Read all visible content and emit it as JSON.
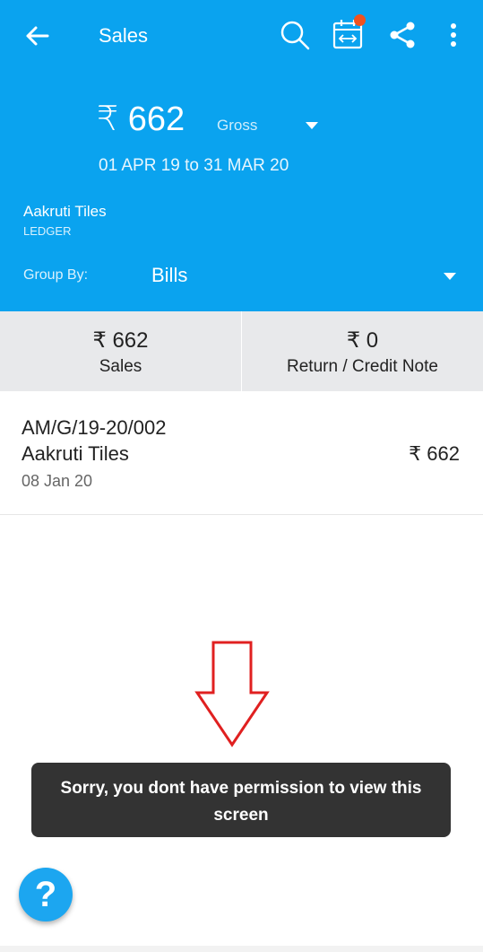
{
  "header": {
    "title": "Sales",
    "amount": "₹ 662",
    "type_select": "Gross",
    "period": "01 APR 19 to 31 MAR 20",
    "ledger_name": "Aakruti Tiles",
    "ledger_type": "LEDGER",
    "group_by_label": "Group By:",
    "group_by_value": "Bills",
    "icons": [
      "back-arrow-icon",
      "search-icon",
      "calendar-range-icon",
      "share-icon",
      "more-vert-icon"
    ],
    "colors": {
      "background": "#0aa3ef",
      "badge": "#f0521e"
    }
  },
  "summary": [
    {
      "value": "₹ 662",
      "label": "Sales"
    },
    {
      "value": "₹ 0",
      "label": "Return / Credit Note"
    }
  ],
  "bills": [
    {
      "number": "AM/G/19-20/002",
      "party": "Aakruti Tiles",
      "date": "08 Jan 20",
      "amount": "₹ 662"
    }
  ],
  "toast": {
    "message": "Sorry, you dont have permission to view this screen"
  },
  "help": {
    "label": "?"
  },
  "annotation": {
    "color": "#e02020"
  }
}
